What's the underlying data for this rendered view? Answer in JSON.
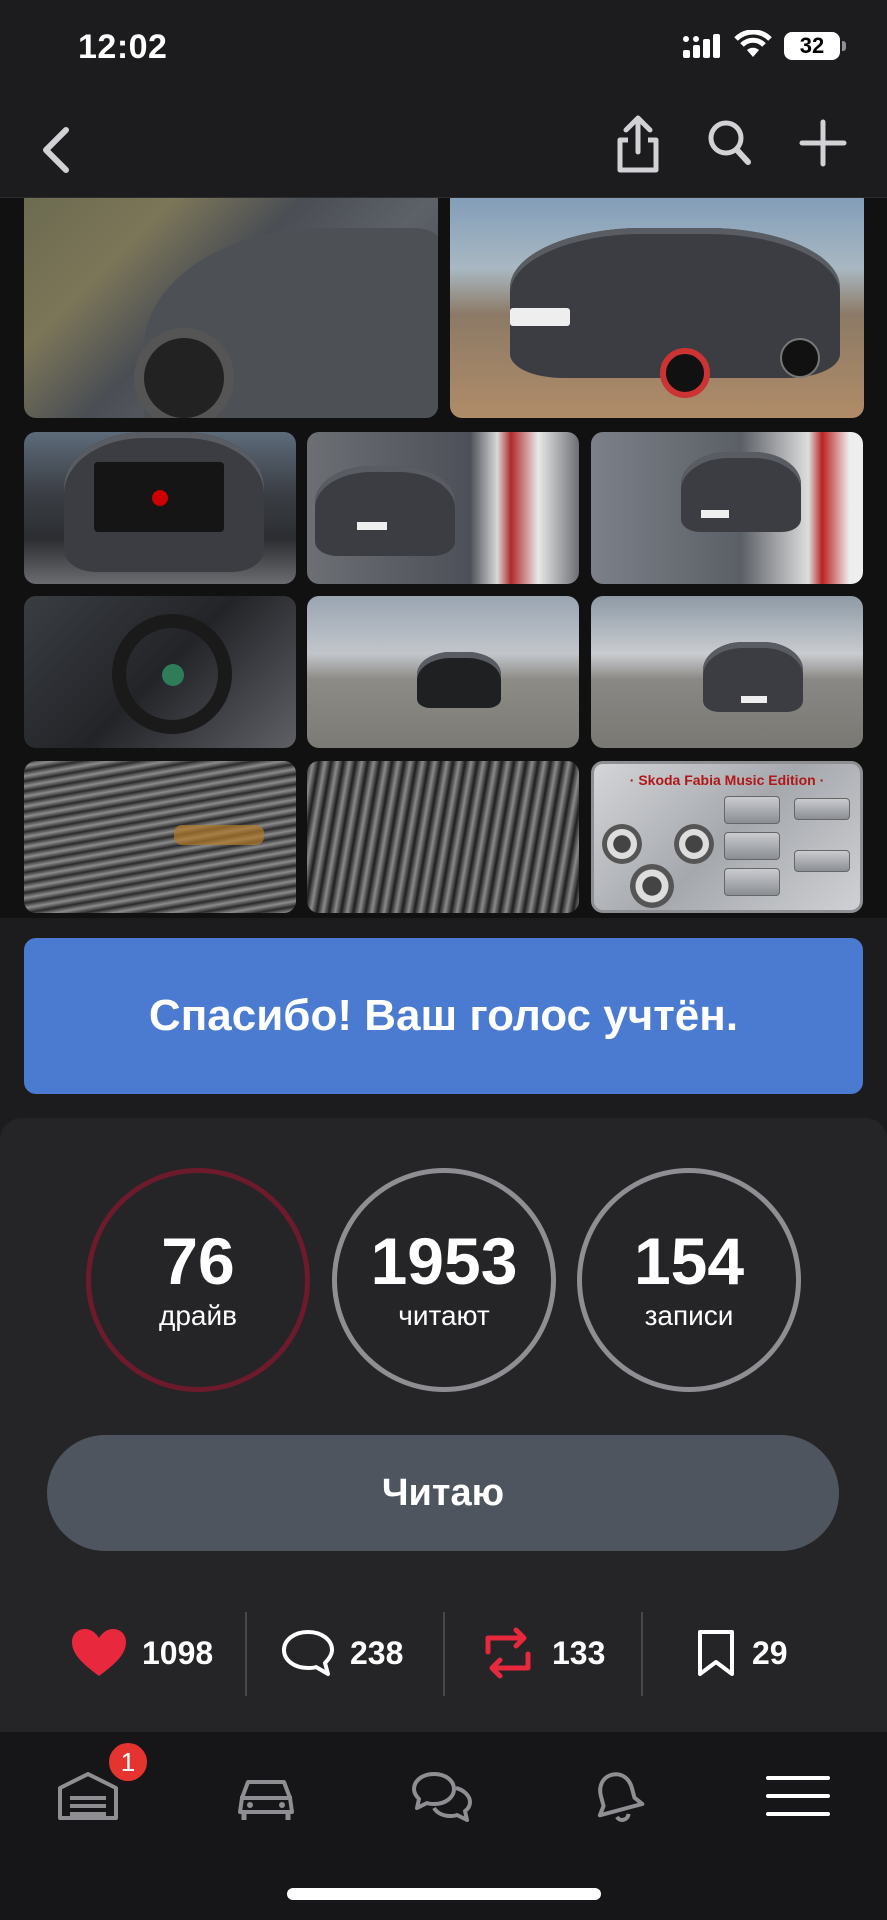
{
  "status_bar": {
    "time": "12:02",
    "battery": "32"
  },
  "gallery": {
    "music_title": "· Skoda Fabia Music Edition ·"
  },
  "vote_banner": {
    "text": "Спасибо! Ваш голос учтён."
  },
  "stats": [
    {
      "value": "76",
      "label": "драйв"
    },
    {
      "value": "1953",
      "label": "читают"
    },
    {
      "value": "154",
      "label": "записи"
    }
  ],
  "follow_button": {
    "label": "Читаю"
  },
  "actions": {
    "likes": "1098",
    "comments": "238",
    "reposts": "133",
    "bookmarks": "29"
  },
  "tabbar": {
    "garage_badge": "1"
  },
  "colors": {
    "accent_blue": "#4a7bd0",
    "like_red": "#e8283c",
    "repost_red": "#e8283c"
  }
}
